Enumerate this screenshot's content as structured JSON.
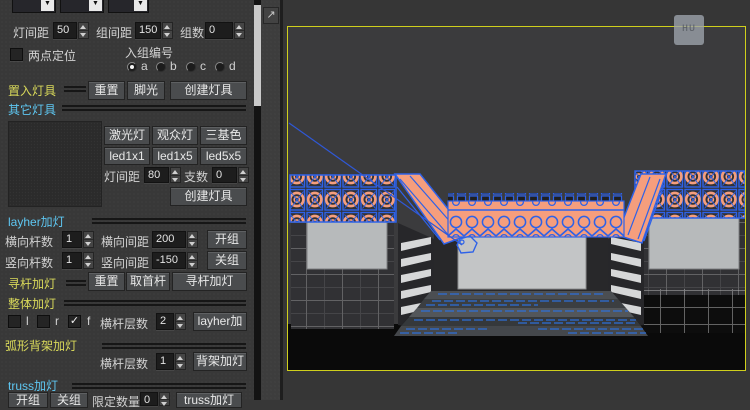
{
  "colors": {
    "panel_bg": "#383838",
    "accent_yellow": "#d9d95a",
    "accent_cyan": "#5ec7f2",
    "selection_orange": "#f59e7d",
    "selection_blue": "#2e62e8",
    "viewport_border": "#cfcf1c",
    "screen_gray": "#bdbfc0"
  },
  "icons": {
    "dropdown": "▼",
    "pan_arrow": "↗",
    "check": "✓"
  },
  "panel": {
    "spacing_row": {
      "lamp_label": "灯间距",
      "lamp_value": "50",
      "group_label": "组间距",
      "group_value": "150",
      "count_label": "组数",
      "count_value": "0"
    },
    "two_point": {
      "label": "两点定位"
    },
    "group_no": {
      "label": "入组编号",
      "options": [
        "a",
        "b",
        "c",
        "d"
      ],
      "selected": "a"
    },
    "place": {
      "title": "置入灯具",
      "reset": "重置",
      "foot": "脚光",
      "create": "创建灯具"
    },
    "other": {
      "title": "其它灯具",
      "laser": "激光灯",
      "audience": "观众灯",
      "tricolor": "三基色",
      "led11": "led1x1",
      "led15": "led1x5",
      "led55": "led5x5",
      "lamp_label": "灯间距",
      "lamp_value": "80",
      "branch_label": "支数",
      "branch_value": "0",
      "create": "创建灯具"
    },
    "layher": {
      "title": "layher加灯",
      "h_count_label": "横向杆数",
      "h_count": "1",
      "h_gap_label": "横向间距",
      "h_gap": "200",
      "open": "开组",
      "v_count_label": "竖向杆数",
      "v_count": "1",
      "v_gap_label": "竖向间距",
      "v_gap": "-150",
      "close": "关组"
    },
    "seek": {
      "title": "寻杆加灯",
      "reset": "重置",
      "first": "取首杆",
      "go": "寻杆加灯"
    },
    "whole": {
      "title": "整体加灯",
      "cb_l": "l",
      "cb_r": "r",
      "cb_f": "f",
      "layers_label": "横杆层数",
      "layers": "2",
      "button": "layher加灯"
    },
    "arc": {
      "title": "弧形背架加灯",
      "layers_label": "横杆层数",
      "layers": "1",
      "button": "背架加灯"
    },
    "truss": {
      "title": "truss加灯",
      "open": "开组",
      "close": "关组",
      "limit_label": "限定数量",
      "limit": "0",
      "button": "truss加灯"
    }
  }
}
